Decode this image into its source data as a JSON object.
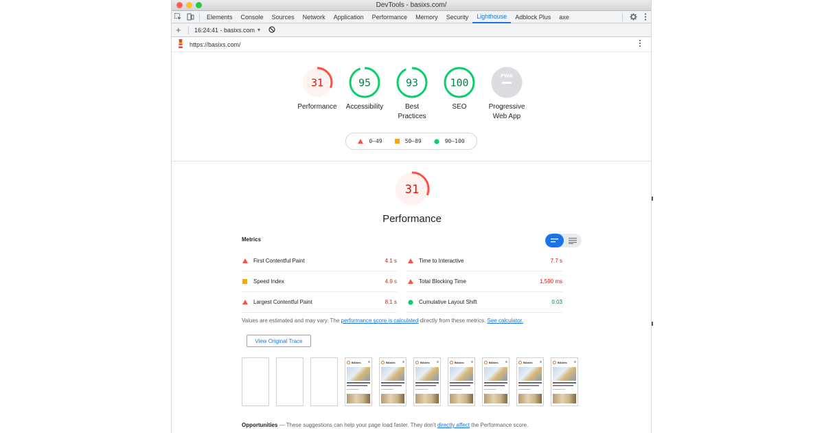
{
  "window": {
    "title": "DevTools - basixs.com/",
    "traffic_lights": [
      "#fe5f57",
      "#febc2e",
      "#28c840"
    ]
  },
  "devtools_tabs": [
    "Elements",
    "Console",
    "Sources",
    "Network",
    "Application",
    "Performance",
    "Memory",
    "Security",
    "Lighthouse",
    "Adblock Plus",
    "axe"
  ],
  "active_tab": "Lighthouse",
  "report_bar": {
    "add": "+",
    "report_selector": "16:24:41 - basixs.com",
    "chevron": "▾"
  },
  "url": "https://basixs.com/",
  "gauges": [
    {
      "score": "31",
      "label": "Performance",
      "fraction": 0.31,
      "color": "#ff4e42",
      "fill": "#fff3f2",
      "text_color": "#eb0f00"
    },
    {
      "score": "95",
      "label": "Accessibility",
      "fraction": 0.95,
      "color": "#0cce6b",
      "fill": "#ffffff",
      "text_color": "#018642"
    },
    {
      "score": "93",
      "label_line1": "Best",
      "label_line2": "Practices",
      "fraction": 0.93,
      "color": "#0cce6b",
      "fill": "#ffffff",
      "text_color": "#018642"
    },
    {
      "score": "100",
      "label": "SEO",
      "fraction": 1.0,
      "color": "#0cce6b",
      "fill": "#ffffff",
      "text_color": "#018642"
    },
    {
      "badge": "PWA",
      "label_line1": "Progressive",
      "label_line2": "Web App",
      "fraction": 0,
      "color": "#cccccc",
      "fill": "#e0e0e0"
    }
  ],
  "legend": [
    {
      "shape": "triangle",
      "range": "0–49",
      "color": "#ff4e42"
    },
    {
      "shape": "square",
      "range": "50–89",
      "color": "#ffa400"
    },
    {
      "shape": "circle",
      "range": "90–100",
      "color": "#0cce6b"
    }
  ],
  "performance": {
    "score": "31",
    "fraction": 0.31,
    "title": "Performance",
    "metrics_heading": "Metrics",
    "metrics_left": [
      {
        "name": "First Contentful Paint",
        "value": "4.1 s",
        "status": "fail"
      },
      {
        "name": "Speed Index",
        "value": "4.9 s",
        "status": "average"
      },
      {
        "name": "Largest Contentful Paint",
        "value": "8.1 s",
        "status": "fail"
      }
    ],
    "metrics_right": [
      {
        "name": "Time to Interactive",
        "value": "7.7 s",
        "status": "fail"
      },
      {
        "name": "Total Blocking Time",
        "value": "1,590 ms",
        "status": "fail"
      },
      {
        "name": "Cumulative Layout Shift",
        "value": "0.03",
        "status": "pass"
      }
    ],
    "note_prefix": "Values are estimated and may vary. The ",
    "note_link1": "performance score is calculated",
    "note_middle": " directly from these metrics. ",
    "note_link2": "See calculator.",
    "trace_button": "View Original Trace",
    "filmstrip_brand": "BAsixs",
    "opportunities_title": "Opportunities",
    "opportunities_dash": " — ",
    "opportunities_text": "These suggestions can help your page load faster. They don't ",
    "opportunities_link": "directly affect",
    "opportunities_suffix": " the Performance score."
  },
  "status_colors": {
    "fail": "#eb0f00",
    "average": "#c33300",
    "pass": "#018642"
  }
}
